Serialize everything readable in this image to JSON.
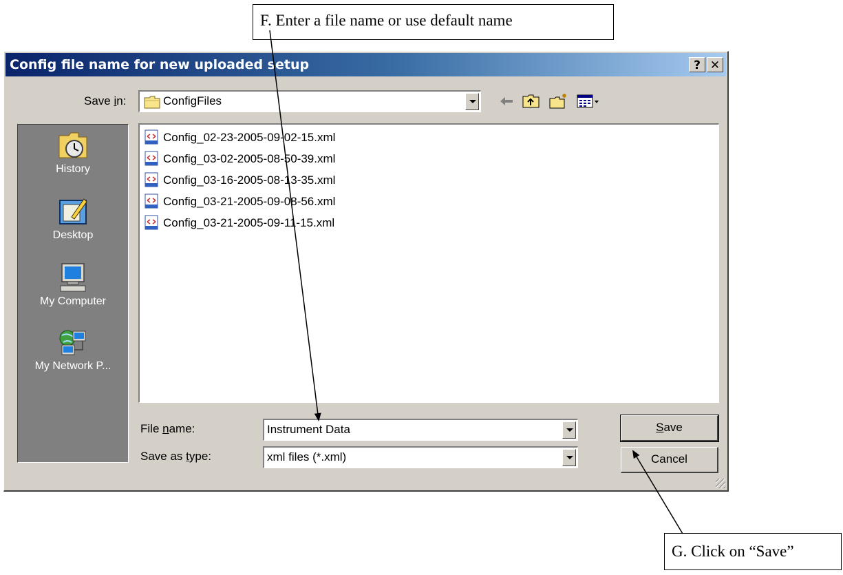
{
  "callouts": {
    "f": "F. Enter a file name or use default name",
    "g": "G. Click on “Save”"
  },
  "dialog": {
    "title": "Config file name for new uploaded setup",
    "help_button": "?",
    "close_button": "✕"
  },
  "save_in": {
    "label_pre": "Save ",
    "label_key": "i",
    "label_post": "n:",
    "value": "ConfigFiles"
  },
  "places": [
    {
      "label": "History",
      "icon": "history-icon"
    },
    {
      "label": "Desktop",
      "icon": "desktop-icon"
    },
    {
      "label": "My Computer",
      "icon": "my-computer-icon"
    },
    {
      "label": "My Network P...",
      "icon": "network-places-icon"
    }
  ],
  "files": [
    "Config_02-23-2005-09-02-15.xml",
    "Config_03-02-2005-08-50-39.xml",
    "Config_03-16-2005-08-13-35.xml",
    "Config_03-21-2005-09-08-56.xml",
    "Config_03-21-2005-09-11-15.xml"
  ],
  "file_name": {
    "label_pre": "File ",
    "label_key": "n",
    "label_post": "ame:",
    "value": "Instrument Data"
  },
  "save_as_type": {
    "label_pre": "Save as ",
    "label_key": "t",
    "label_post": "ype:",
    "value": "xml files (*.xml)"
  },
  "buttons": {
    "save_key": "S",
    "save_rest": "ave",
    "cancel": "Cancel"
  },
  "colors": {
    "title_gradient_start": "#0a246a",
    "title_gradient_end": "#a6caf0",
    "dialog_face": "#d4d0c8",
    "places_bar": "#808080"
  }
}
